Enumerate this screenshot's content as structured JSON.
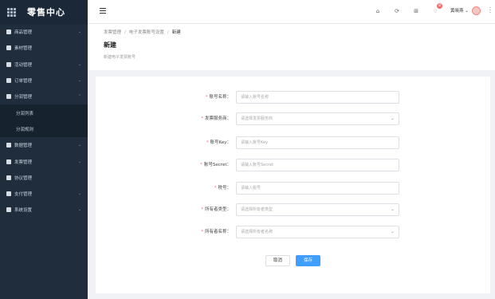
{
  "app": {
    "title": "零售中心"
  },
  "sidebar": {
    "items": [
      {
        "label": "商品管理",
        "icon": "tag-icon",
        "arrow": "⌄"
      },
      {
        "label": "素材管理",
        "icon": "image-icon",
        "arrow": ""
      },
      {
        "label": "活动管理",
        "icon": "calendar-icon",
        "arrow": "⌄"
      },
      {
        "label": "订单管理",
        "icon": "order-icon",
        "arrow": "⌄"
      },
      {
        "label": "分润管理",
        "icon": "share-icon",
        "arrow": "⌃"
      },
      {
        "label": "分润列表",
        "sub": true
      },
      {
        "label": "分润规则",
        "sub": true
      },
      {
        "label": "数据管理",
        "icon": "chart-icon",
        "arrow": "⌄"
      },
      {
        "label": "发票管理",
        "icon": "invoice-icon",
        "arrow": "⌄"
      },
      {
        "label": "协议管理",
        "icon": "doc-icon",
        "arrow": ""
      },
      {
        "label": "支付管理",
        "icon": "wallet-icon",
        "arrow": "⌄"
      },
      {
        "label": "系统设置",
        "icon": "gear-icon",
        "arrow": "⌄"
      }
    ]
  },
  "header": {
    "badge_count": "8",
    "username": "黄晓燕",
    "user_arrow": "⌄",
    "icons": [
      "home-icon",
      "refresh-icon",
      "grid-icon",
      "bell-icon",
      "more-icon"
    ]
  },
  "breadcrumb": {
    "items": [
      "发票管理",
      "电子发票账号设置",
      "新建"
    ],
    "sep": "/"
  },
  "page": {
    "title": "新建",
    "desc": "新建电子发票账号"
  },
  "form": {
    "fields": [
      {
        "label": "账号名称：",
        "placeholder": "请输入账号名称",
        "type": "input"
      },
      {
        "label": "发票服务商：",
        "placeholder": "请选择发票服务商",
        "type": "select"
      },
      {
        "label": "账号Key：",
        "placeholder": "请输入账号Key",
        "type": "input"
      },
      {
        "label": "账号Secret：",
        "placeholder": "请输入账号Secret",
        "type": "input"
      },
      {
        "label": "税号：",
        "placeholder": "请输入税号",
        "type": "input"
      },
      {
        "label": "所有者类型：",
        "placeholder": "请选择所有者类型",
        "type": "select"
      },
      {
        "label": "所有者名称：",
        "placeholder": "请选择所有者名称",
        "type": "select"
      }
    ],
    "required_mark": "*",
    "cancel_label": "取消",
    "save_label": "保存"
  }
}
